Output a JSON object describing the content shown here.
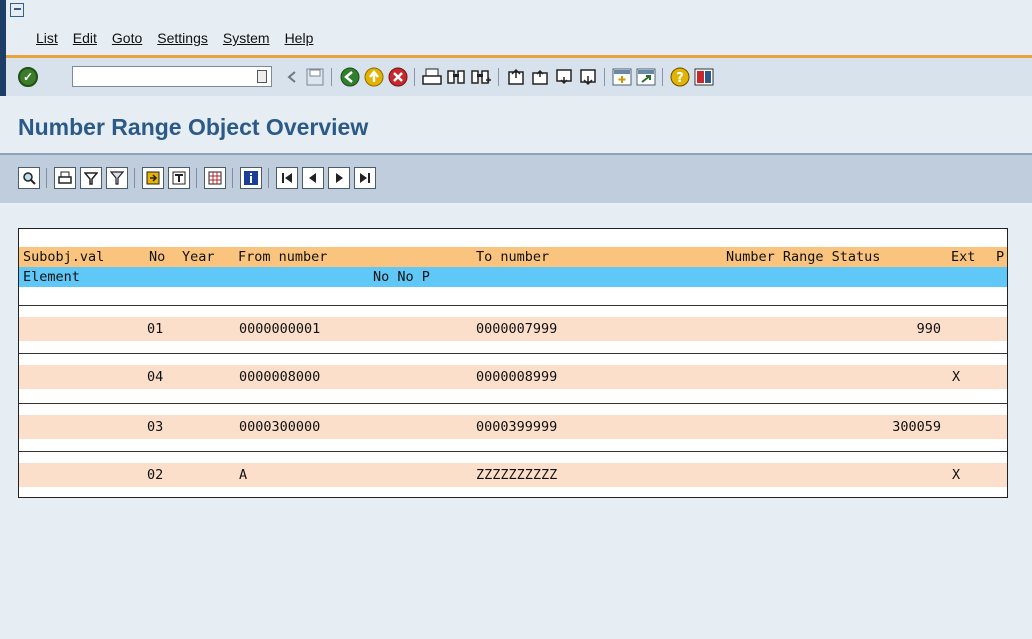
{
  "menu": [
    "List",
    "Edit",
    "Goto",
    "Settings",
    "System",
    "Help"
  ],
  "title": "Number Range Object Overview",
  "list": {
    "header1": {
      "subobj": "Subobj.val",
      "no": "No",
      "year": "Year",
      "from": "From number",
      "to": "To number",
      "status": "Number Range Status",
      "ext": "Ext",
      "p": "P"
    },
    "header2": {
      "element": "Element",
      "no_no_p": "No No P"
    },
    "rows": [
      {
        "no": "01",
        "from": "0000000001",
        "to": "0000007999",
        "status": "990",
        "ext": ""
      },
      {
        "no": "04",
        "from": "0000008000",
        "to": "0000008999",
        "status": "",
        "ext": "X"
      },
      {
        "no": "03",
        "from": "0000300000",
        "to": "0000399999",
        "status": "300059",
        "ext": ""
      },
      {
        "no": "02",
        "from": "A",
        "to": "ZZZZZZZZZZ",
        "status": "",
        "ext": "X"
      }
    ]
  }
}
